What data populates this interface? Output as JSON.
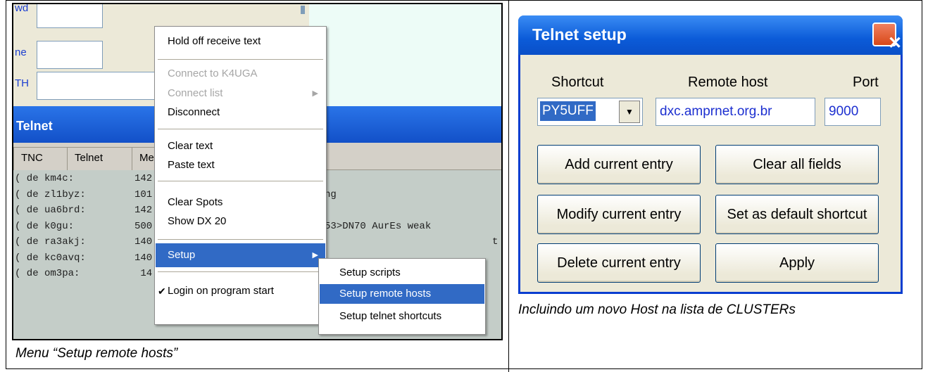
{
  "left_panel": {
    "form_labels": [
      "wd",
      "ne",
      "TH"
    ],
    "telnet_title": "Telnet",
    "tabs": [
      "TNC",
      "Telnet",
      "Me"
    ],
    "terminal_lines": [
      {
        "call": "( de km4c:",
        "freq": "142",
        "text": ""
      },
      {
        "call": "( de zl1byz:",
        "freq": "101",
        "text": "ng"
      },
      {
        "call": "( de ua6brd:",
        "freq": "142",
        "text": ""
      },
      {
        "call": "( de k0gu:",
        "freq": "500",
        "text": "53>DN70 AurEs weak"
      },
      {
        "call": "( de ra3akj:",
        "freq": "140",
        "text": ""
      },
      {
        "call": "( de kc0avq:",
        "freq": "140",
        "text": ""
      },
      {
        "call": "( de om3pa:",
        "freq": " 14",
        "text": ""
      }
    ],
    "terminal_trailing": "t",
    "context_menu": {
      "hold_off": "Hold off receive text",
      "connect_to": "Connect to K4UGA",
      "connect_list": "Connect list",
      "disconnect": "Disconnect",
      "clear_text": "Clear text",
      "paste_text": "Paste text",
      "clear_spots": "Clear Spots",
      "show_dx": "Show DX 20",
      "setup": "Setup",
      "login": "Login on program start"
    },
    "submenu": {
      "scripts": "Setup scripts",
      "remote_hosts": "Setup remote hosts",
      "telnet_shortcuts": "Setup telnet shortcuts"
    },
    "caption": "Menu “Setup remote hosts”"
  },
  "right_panel": {
    "dialog_title": "Telnet setup",
    "close_glyph": "✕",
    "labels": {
      "shortcut": "Shortcut",
      "remote_host": "Remote host",
      "port": "Port"
    },
    "values": {
      "shortcut": "PY5UFF",
      "remote_host": "dxc.amprnet.org.br",
      "port": "9000"
    },
    "combo_arrow": "▼",
    "buttons": {
      "add": "Add current entry",
      "clear": "Clear all fields",
      "modify": "Modify current entry",
      "default": "Set as default shortcut",
      "delete": "Delete current entry",
      "apply": "Apply"
    },
    "caption": "Incluindo um novo Host na lista de CLUSTERs"
  },
  "colors": {
    "menu_highlight": "#316ac5",
    "title_bar": "#0b5bd8",
    "input_text": "#1c2fd0"
  }
}
